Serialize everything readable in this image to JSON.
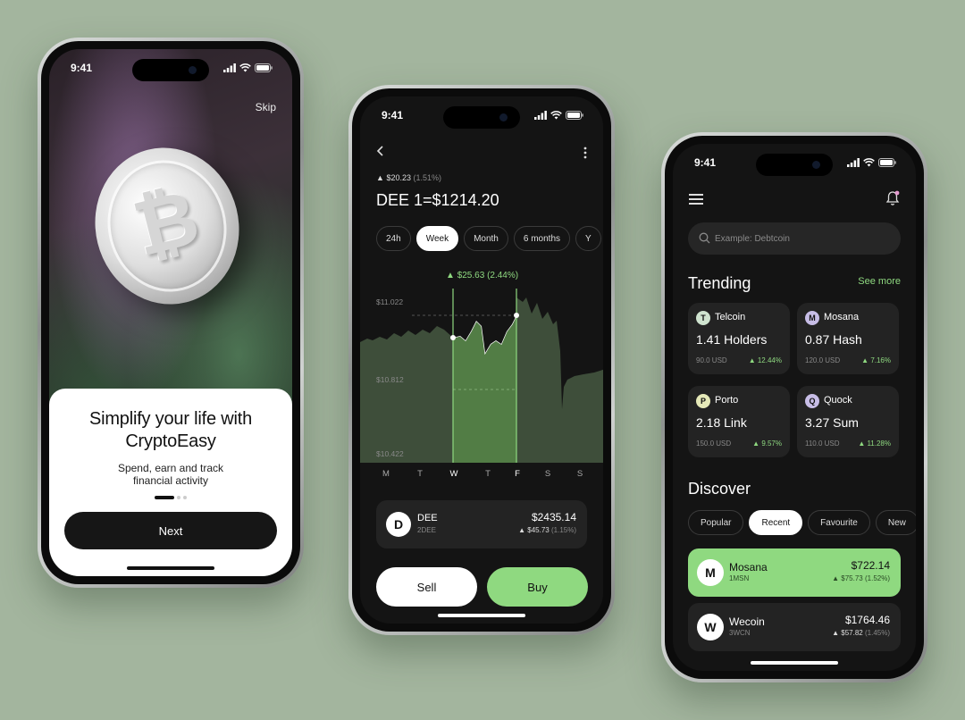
{
  "colors": {
    "background": "#a3b59e",
    "accent_green": "#8fd980",
    "screen_dark": "#141414",
    "card_dark": "#232323"
  },
  "status_time": "9:41",
  "onboarding": {
    "skip_label": "Skip",
    "coin_icon": "bitcoin-coin-icon",
    "title": "Simplify your life with CryptoEasy",
    "subtitle": "Spend, earn and track financial activity",
    "page_indicator": {
      "current": 1,
      "total": 3
    },
    "next_label": "Next"
  },
  "detail": {
    "change_top": "$20.23",
    "change_top_pct": "(1.51%)",
    "title": "DEE 1=$1214.20",
    "ranges": [
      "24h",
      "Week",
      "Month",
      "6 months",
      "Y"
    ],
    "active_range": "Week",
    "chart_data": {
      "type": "area",
      "x": [
        "M",
        "T",
        "W",
        "T",
        "F",
        "S",
        "S"
      ],
      "y_ticks": [
        "$11.022",
        "$10.812",
        "$10.422"
      ],
      "highlight_label": "$25.63",
      "highlight_pct": "(2.44%)",
      "highlight_range": [
        "W",
        "F"
      ]
    },
    "holding": {
      "name": "DEE",
      "symbol": "2DEE",
      "price": "$2435.14",
      "delta": "$45.73",
      "delta_pct": "(1.15%)"
    },
    "sell_label": "Sell",
    "buy_label": "Buy"
  },
  "home": {
    "search_placeholder": "Example: Debtcoin",
    "trending_title": "Trending",
    "see_more_label": "See more",
    "trending": [
      {
        "name": "Telcoin",
        "value": "1.41 Holders",
        "usd": "90.0 USD",
        "change": "12.44%",
        "logo_letter": "T",
        "logo_color": "#cfe3cf"
      },
      {
        "name": "Mosana",
        "value": "0.87 Hash",
        "usd": "120.0 USD",
        "change": "7.16%",
        "logo_letter": "M",
        "logo_color": "#c7bde6"
      },
      {
        "name": "Porto",
        "value": "2.18 Link",
        "usd": "150.0 USD",
        "change": "9.57%",
        "logo_letter": "P",
        "logo_color": "#e5e9b8"
      },
      {
        "name": "Quock",
        "value": "3.27 Sum",
        "usd": "110.0 USD",
        "change": "11.28%",
        "logo_letter": "Q",
        "logo_color": "#c7bde6"
      }
    ],
    "discover_title": "Discover",
    "filters": [
      "Popular",
      "Recent",
      "Favourite",
      "New"
    ],
    "active_filter": "Recent",
    "discover_rows": [
      {
        "name": "Mosana",
        "symbol": "1MSN",
        "price": "$722.14",
        "delta": "$75.73",
        "delta_pct": "(1.52%)",
        "logo_letter": "M"
      },
      {
        "name": "Wecoin",
        "symbol": "3WCN",
        "price": "$1764.46",
        "delta": "$57.82",
        "delta_pct": "(1.45%)",
        "logo_letter": "W"
      }
    ]
  }
}
